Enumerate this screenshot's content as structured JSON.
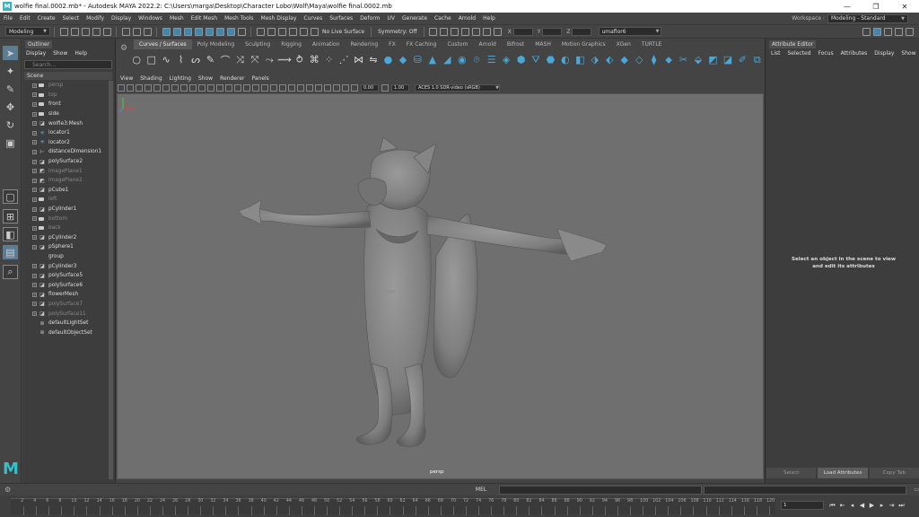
{
  "titlebar": {
    "title": "wolfie final.0002.mb* - Autodesk MAYA 2022.2: C:\\Users\\marga\\Desktop\\Character Lobo\\Wolf\\Maya\\wolfie final.0002.mb",
    "minimize": "—",
    "maximize": "❐",
    "close": "✕"
  },
  "menubar": {
    "items": [
      "File",
      "Edit",
      "Create",
      "Select",
      "Modify",
      "Display",
      "Windows",
      "Mesh",
      "Edit Mesh",
      "Mesh Tools",
      "Mesh Display",
      "Curves",
      "Surfaces",
      "Deform",
      "UV",
      "Generate",
      "Cache",
      "Arnold",
      "Help"
    ],
    "workspace_label": "Workspace :",
    "workspace_value": "Modeling - Standard"
  },
  "statusline": {
    "mode": "Modeling",
    "live_surface": "No Live Surface",
    "symmetry": "Symmetry: Off",
    "x_label": "X",
    "y_label": "Y",
    "z_label": "Z",
    "camera": "umaflor6"
  },
  "outliner": {
    "tab": "Outliner",
    "menu": [
      "Display",
      "Show",
      "Help"
    ],
    "search_placeholder": "Search...",
    "scene_label": "Scene",
    "items": [
      {
        "label": "persp",
        "icon": "camera",
        "dim": true
      },
      {
        "label": "top",
        "icon": "camera",
        "dim": true
      },
      {
        "label": "front",
        "icon": "camera",
        "dim": false
      },
      {
        "label": "side",
        "icon": "camera",
        "dim": false
      },
      {
        "label": "wolfie3:Mesh",
        "icon": "mesh",
        "dim": false
      },
      {
        "label": "locator1",
        "icon": "locator",
        "dim": false
      },
      {
        "label": "locator2",
        "icon": "locator",
        "dim": false
      },
      {
        "label": "distanceDimension1",
        "icon": "dimension",
        "dim": false
      },
      {
        "label": "polySurface2",
        "icon": "mesh",
        "dim": false
      },
      {
        "label": "imagePlane1",
        "icon": "image",
        "dim": true
      },
      {
        "label": "imagePlane2",
        "icon": "image",
        "dim": true
      },
      {
        "label": "pCube1",
        "icon": "mesh",
        "dim": false
      },
      {
        "label": "left",
        "icon": "camera",
        "dim": true
      },
      {
        "label": "pCylinder1",
        "icon": "mesh",
        "dim": false
      },
      {
        "label": "bottom",
        "icon": "camera",
        "dim": true
      },
      {
        "label": "back",
        "icon": "camera",
        "dim": true
      },
      {
        "label": "pCylinder2",
        "icon": "mesh",
        "dim": false
      },
      {
        "label": "pSphere1",
        "icon": "mesh",
        "dim": false
      },
      {
        "label": "group",
        "icon": "group",
        "dim": false
      },
      {
        "label": "pCylinder3",
        "icon": "mesh",
        "dim": false
      },
      {
        "label": "polySurface5",
        "icon": "mesh",
        "dim": false
      },
      {
        "label": "polySurface6",
        "icon": "mesh",
        "dim": false
      },
      {
        "label": "flowerMesh",
        "icon": "mesh",
        "dim": false
      },
      {
        "label": "polySurface7",
        "icon": "mesh",
        "dim": true
      },
      {
        "label": "polySurface11",
        "icon": "mesh",
        "dim": true
      },
      {
        "label": "defaultLightSet",
        "icon": "set",
        "dim": false
      },
      {
        "label": "defaultObjectSet",
        "icon": "set",
        "dim": false
      }
    ]
  },
  "shelf": {
    "tabs": [
      "Curves / Surfaces",
      "Poly Modeling",
      "Sculpting",
      "Rigging",
      "Animation",
      "Rendering",
      "FX",
      "FX Caching",
      "Custom",
      "Arnold",
      "Bifrost",
      "MASH",
      "Motion Graphics",
      "XGen",
      "TURTLE"
    ],
    "active_tab": 0
  },
  "viewport": {
    "menu": [
      "View",
      "Shading",
      "Lighting",
      "Show",
      "Renderer",
      "Panels"
    ],
    "field_1": "0.00",
    "field_2": "1.00",
    "color_space": "ACES 1.0 SDR-video (sRGB)",
    "camera_label": "persp",
    "annotation": "186"
  },
  "attribute_editor": {
    "tab": "Attribute Editor",
    "menu": [
      "List",
      "Selected",
      "Focus",
      "Attributes",
      "Display",
      "Show"
    ],
    "message_line1": "Select an object in the scene to view",
    "message_line2": "and edit its attributes",
    "btn_select": "Select",
    "btn_load": "Load Attributes",
    "btn_copy": "Copy Tab"
  },
  "cmdline": {
    "label": "MEL"
  },
  "timeline": {
    "ticks": [
      2,
      4,
      6,
      8,
      10,
      12,
      14,
      16,
      18,
      20,
      22,
      24,
      26,
      28,
      30,
      32,
      34,
      36,
      38,
      40,
      42,
      44,
      46,
      48,
      50,
      52,
      54,
      56,
      58,
      60,
      62,
      64,
      66,
      68,
      70,
      72,
      74,
      76,
      78,
      80,
      82,
      84,
      86,
      88,
      90,
      92,
      94,
      96,
      98,
      100,
      102,
      104,
      106,
      108,
      110,
      112,
      114,
      116,
      118,
      120
    ],
    "current_frame": "1"
  },
  "colors": {
    "accent": "#5b7d94",
    "maya_logo": "#33c1cc",
    "shelf_blue": "#49a8d8"
  }
}
